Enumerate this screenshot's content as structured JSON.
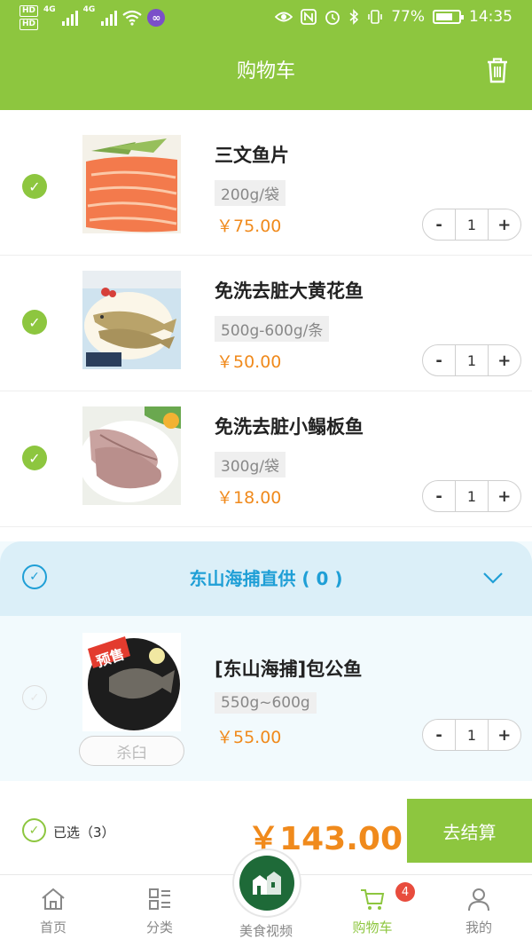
{
  "status_bar": {
    "hd_label": "HD",
    "network_1": "4G",
    "network_2": "4G",
    "vpn_icon": "∞",
    "battery_percent": "77%",
    "battery_level": 0.77,
    "time": "14:35"
  },
  "header": {
    "title": "购物车",
    "trash_icon": "trash-icon"
  },
  "items": [
    {
      "name": "三文鱼片",
      "spec": "200g/袋",
      "price": "￥75.00",
      "qty": "1",
      "selected": true
    },
    {
      "name": "免洗去脏大黄花鱼",
      "spec": "500g-600g/条",
      "price": "￥50.00",
      "qty": "1",
      "selected": true
    },
    {
      "name": "免洗去脏小鳎板鱼",
      "spec": "300g/袋",
      "price": "￥18.00",
      "qty": "1",
      "selected": true
    }
  ],
  "stepper": {
    "minus": "-",
    "plus": "+"
  },
  "group": {
    "title": "东山海捕直供 ( 0 )",
    "item": {
      "name": "[东山海捕]包公鱼",
      "spec": "550g~600g",
      "price": "￥55.00",
      "qty": "1",
      "tag": "预售",
      "status": "杀臼"
    }
  },
  "summary": {
    "selected_label": "已选（3）",
    "total": "￥143.00",
    "checkout_label": "去结算"
  },
  "tabbar": {
    "tabs": [
      {
        "label": "首页",
        "icon": "home-icon"
      },
      {
        "label": "分类",
        "icon": "category-icon"
      },
      {
        "label": "美食视频",
        "icon": "video-logo-icon"
      },
      {
        "label": "购物车",
        "icon": "cart-icon",
        "active": true
      },
      {
        "label": "我的",
        "icon": "user-icon"
      }
    ],
    "cart_badge": "4"
  },
  "colors": {
    "brand_green": "#8dc63f",
    "price_orange": "#f08a1c",
    "group_blue": "#1f9fd6",
    "badge_red": "#e84c3d"
  }
}
